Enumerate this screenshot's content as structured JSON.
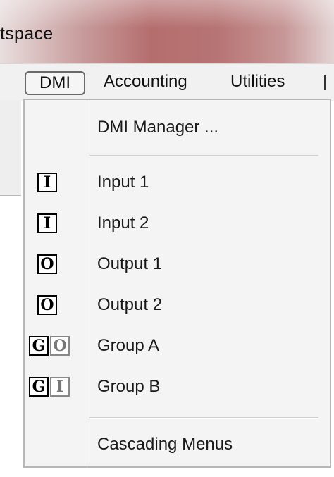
{
  "window": {
    "title": "tspace"
  },
  "menubar": {
    "items": [
      {
        "label": "DMI"
      },
      {
        "label": "Accounting"
      },
      {
        "label": "Utilities"
      }
    ]
  },
  "dropdown": {
    "items": [
      {
        "label": "DMI Manager ...",
        "icons": []
      },
      {
        "label": "Input 1",
        "icons": [
          "I"
        ]
      },
      {
        "label": "Input 2",
        "icons": [
          "I"
        ]
      },
      {
        "label": "Output 1",
        "icons": [
          "O"
        ]
      },
      {
        "label": "Output 2",
        "icons": [
          "O"
        ]
      },
      {
        "label": "Group A",
        "icons": [
          "G",
          "O"
        ]
      },
      {
        "label": "Group B",
        "icons": [
          "G",
          "I"
        ]
      },
      {
        "label": "Cascading Menus",
        "icons": []
      }
    ]
  },
  "colors": {
    "title_gradient_mid": "#b56e6e",
    "menu_bg": "#f4f4f4",
    "icon_border": "#000000",
    "icon_secondary": "#888888"
  }
}
